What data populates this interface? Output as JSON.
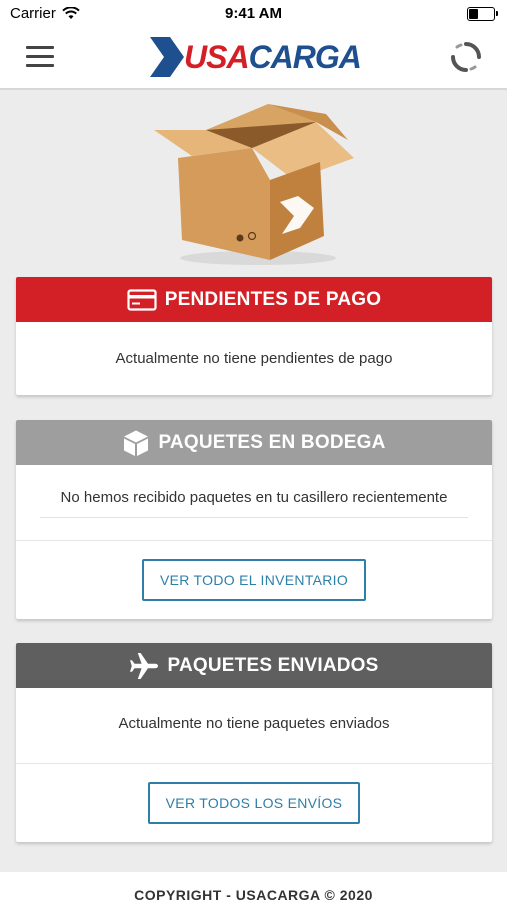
{
  "status_bar": {
    "carrier": "Carrier",
    "time": "9:41 AM"
  },
  "nav": {
    "logo_part1": "USA",
    "logo_part2": "CARGA",
    "menu_icon": "hamburger-icon",
    "refresh_icon": "refresh-spinner-icon"
  },
  "colors": {
    "red": "#d32027",
    "gray_medium": "#9e9e9e",
    "gray_dark": "#5f5f5f",
    "blue": "#2e7fa8",
    "logo_blue": "#1e4f8f"
  },
  "pendientes": {
    "title": "PENDIENTES DE PAGO",
    "message": "Actualmente no tiene pendientes de pago"
  },
  "bodega": {
    "title": "PAQUETES EN BODEGA",
    "message": "No hemos recibido paquetes en tu casillero recientemente",
    "button": "VER TODO EL INVENTARIO"
  },
  "enviados": {
    "title": "PAQUETES ENVIADOS",
    "message": "Actualmente no tiene paquetes enviados",
    "button": "VER TODOS LOS ENVÍOS"
  },
  "footer": {
    "text": "COPYRIGHT - USACARGA © 2020"
  }
}
